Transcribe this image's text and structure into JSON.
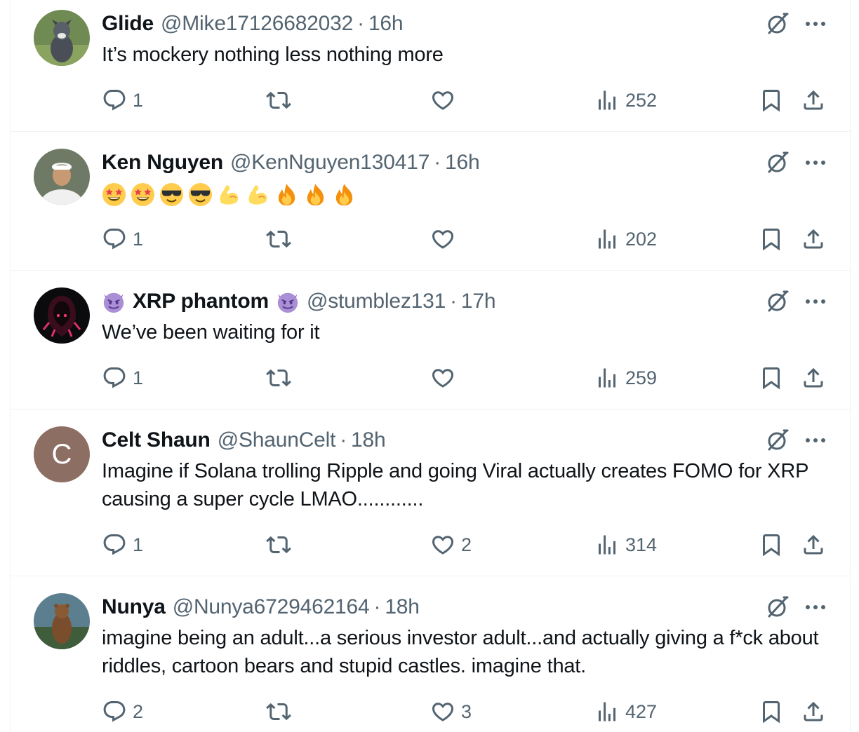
{
  "replies": [
    {
      "name": "Glide",
      "handle": "@Mike17126682032",
      "sep": "·",
      "time": "16h",
      "text": "It’s mockery nothing less nothing more",
      "counts": {
        "reply": "1",
        "retweet": "",
        "like": "",
        "views": "252"
      }
    },
    {
      "name": "Ken Nguyen",
      "handle": "@KenNguyen130417",
      "sep": "·",
      "time": "16h",
      "emojis": [
        "star-struck",
        "star-struck",
        "sunglasses",
        "sunglasses",
        "flexed-biceps",
        "flexed-biceps",
        "fire",
        "fire",
        "fire"
      ],
      "counts": {
        "reply": "1",
        "retweet": "",
        "like": "",
        "views": "202"
      }
    },
    {
      "name": "XRP phantom",
      "handle": "@stumblez131",
      "sep": "·",
      "time": "17h",
      "text": "We’ve been waiting for it",
      "name_emojis": [
        "smiling-devil",
        "smiling-devil"
      ],
      "counts": {
        "reply": "1",
        "retweet": "",
        "like": "",
        "views": "259"
      }
    },
    {
      "name": "Celt Shaun",
      "handle": "@ShaunCelt",
      "sep": "·",
      "time": "18h",
      "avatar_letter": "C",
      "text": "Imagine if Solana trolling Ripple and going Viral actually creates FOMO for XRP causing a super cycle LMAO............",
      "counts": {
        "reply": "1",
        "retweet": "",
        "like": "2",
        "views": "314"
      }
    },
    {
      "name": "Nunya",
      "handle": "@Nunya6729462164",
      "sep": "·",
      "time": "18h",
      "text": "imagine being an adult...a serious investor adult...and actually giving a f*ck about riddles, cartoon bears and stupid castles.  imagine that.",
      "counts": {
        "reply": "2",
        "retweet": "",
        "like": "3",
        "views": "427"
      }
    }
  ],
  "colors": {
    "text": "#0f1419",
    "secondary": "#536471",
    "border": "#eff3f4",
    "avatar_c": "#8d6e63"
  }
}
